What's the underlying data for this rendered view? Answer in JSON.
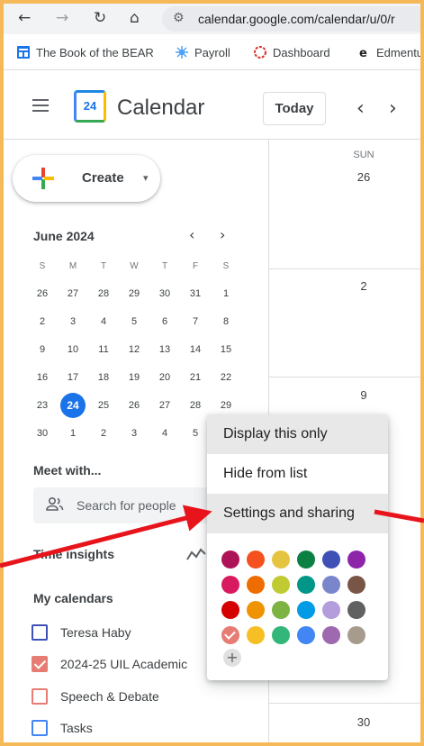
{
  "browser": {
    "nav": {
      "back": "←",
      "forward": "→",
      "reload": "↻",
      "home": "⌂"
    },
    "url": "calendar.google.com/calendar/u/0/r",
    "bookmarks": [
      {
        "label": "The Book of the BEAR",
        "icon": "doc-icon",
        "color": "#1a73e8"
      },
      {
        "label": "Payroll",
        "icon": "payroll-icon",
        "color": "#1a73e8"
      },
      {
        "label": "Dashboard",
        "icon": "dashboard-icon",
        "color": "#d93025"
      },
      {
        "label": "Edmentu",
        "icon": "edmentum-icon",
        "color": "#202124"
      }
    ]
  },
  "header": {
    "logo_day": "24",
    "title": "Calendar",
    "today_label": "Today",
    "prev": "‹",
    "next": "›"
  },
  "create": {
    "label": "Create",
    "caret": "▾"
  },
  "mini_calendar": {
    "title": "June 2024",
    "prev": "‹",
    "next": "›",
    "weekdays": [
      "S",
      "M",
      "T",
      "W",
      "T",
      "F",
      "S"
    ],
    "weeks": [
      [
        "26",
        "27",
        "28",
        "29",
        "30",
        "31",
        "1"
      ],
      [
        "2",
        "3",
        "4",
        "5",
        "6",
        "7",
        "8"
      ],
      [
        "9",
        "10",
        "11",
        "12",
        "13",
        "14",
        "15"
      ],
      [
        "16",
        "17",
        "18",
        "19",
        "20",
        "21",
        "22"
      ],
      [
        "23",
        "24",
        "25",
        "26",
        "27",
        "28",
        "29"
      ],
      [
        "30",
        "1",
        "2",
        "3",
        "4",
        "5",
        "6"
      ]
    ],
    "today": "24"
  },
  "meet": {
    "title": "Meet with...",
    "placeholder": "Search for people"
  },
  "time_insights": {
    "title": "Time insights"
  },
  "my_calendars": {
    "title": "My calendars",
    "items": [
      {
        "label": "Teresa Haby",
        "color": "#3f51b5",
        "checked": false
      },
      {
        "label": "2024-25 UIL Academic",
        "color": "#e67c73",
        "checked": true
      },
      {
        "label": "Speech & Debate",
        "color": "#e67c73",
        "checked": false
      },
      {
        "label": "Tasks",
        "color": "#4285f4",
        "checked": false
      }
    ]
  },
  "grid": {
    "day_name": "SUN",
    "dates": [
      "26",
      "2",
      "9",
      "30"
    ]
  },
  "context_menu": {
    "items": [
      "Display this only",
      "Hide from list",
      "Settings and sharing"
    ],
    "colors": [
      [
        "#ad1457",
        "#f4511e",
        "#e4c441",
        "#0b8043",
        "#3f51b5",
        "#8e24aa"
      ],
      [
        "#d81b60",
        "#ef6c00",
        "#c0ca33",
        "#009688",
        "#7986cb",
        "#795548"
      ],
      [
        "#d50000",
        "#f09300",
        "#7cb342",
        "#039be5",
        "#b39ddb",
        "#616161"
      ],
      [
        "#e67c73",
        "#f6bf26",
        "#33b679",
        "#4285f4",
        "#9e69af",
        "#a79b8e"
      ]
    ],
    "selected_color": "#e67c73",
    "add_label": "+"
  },
  "annotation": {
    "arrow_color": "#e8141c"
  }
}
